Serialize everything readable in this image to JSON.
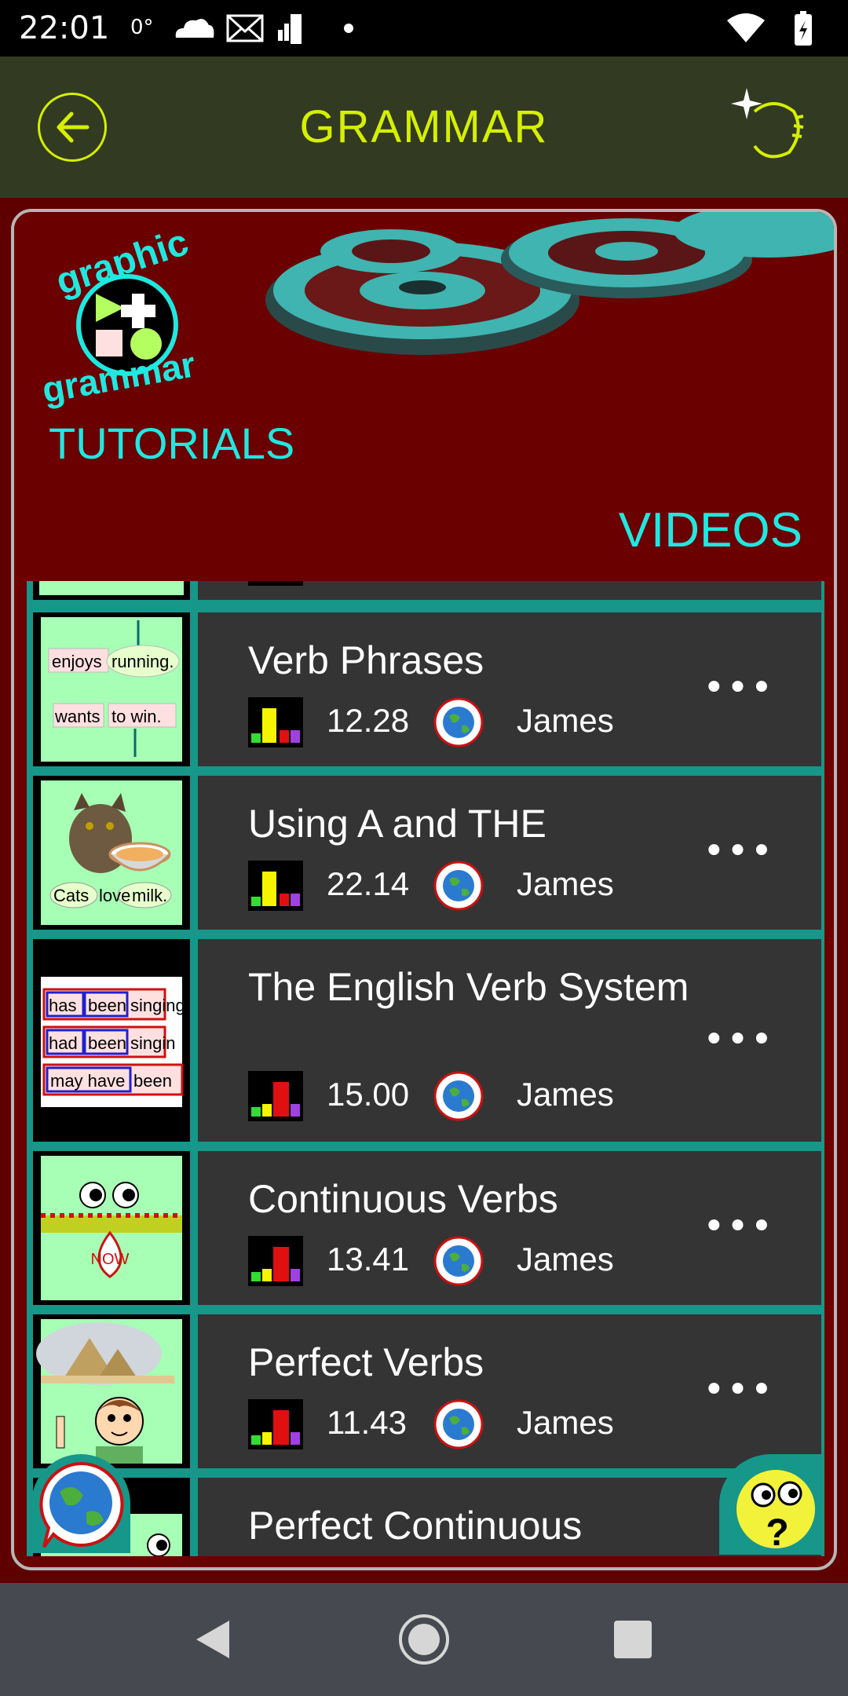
{
  "status_bar": {
    "time": "22:01",
    "temperature": "0°",
    "icons_left": [
      "cloud-icon",
      "mail-icon",
      "signal-bars-icon",
      "dot-icon"
    ],
    "icons_right": [
      "wifi-icon",
      "battery-charging-icon"
    ]
  },
  "app_bar": {
    "title": "GRAMMAR",
    "back_icon": "arrow-left-icon",
    "settings_icon": "sparkle-loop-icon",
    "accent_color": "#d4f000"
  },
  "banner": {
    "logo_top": "graphic",
    "logo_bottom": "grammar",
    "tutorials": "TUTORIALS",
    "videos": "VIDEOS",
    "accent_color": "#1fe8e0"
  },
  "videos": [
    {
      "title": "Verb Phrases",
      "duration": "12.28",
      "author": "James",
      "level": "intermediate",
      "thumb": "verb-phrases-thumbnail",
      "thumb_text": [
        "enjoys",
        "running.",
        "wants",
        "to win."
      ]
    },
    {
      "title": "Using A and THE",
      "duration": "22.14",
      "author": "James",
      "level": "intermediate",
      "thumb": "cat-milk-thumbnail",
      "thumb_text": [
        "Cats",
        "love",
        "milk."
      ]
    },
    {
      "title": "The English Verb System",
      "duration": "15.00",
      "author": "James",
      "level": "advanced",
      "thumb": "verb-system-thumbnail",
      "thumb_text": [
        "has",
        "been",
        "singing",
        "had",
        "been",
        "singin",
        "may have",
        "been"
      ]
    },
    {
      "title": "Continuous Verbs",
      "duration": "13.41",
      "author": "James",
      "level": "advanced",
      "thumb": "continuous-verbs-thumbnail",
      "thumb_text": [
        "NOW"
      ]
    },
    {
      "title": "Perfect Verbs",
      "duration": "11.43",
      "author": "James",
      "level": "advanced",
      "thumb": "perfect-verbs-thumbnail",
      "thumb_text": []
    },
    {
      "title": "Perfect Continuous",
      "duration": "",
      "author": "",
      "level": "",
      "thumb": "perfect-continuous-thumbnail",
      "thumb_text": []
    }
  ],
  "colors": {
    "background": "#5e0000",
    "list_frame": "#17968a",
    "card": "#343434",
    "level_yellow": "#f5f500",
    "level_red": "#e01010",
    "level_green": "#33dd33",
    "level_purple": "#a040e0"
  },
  "fabs": {
    "globe_icon": "globe-speech-icon",
    "help_icon": "question-face-icon"
  },
  "nav_bar": {
    "back_icon": "triangle-back-icon",
    "home_icon": "circle-home-icon",
    "recents_icon": "square-recents-icon"
  }
}
